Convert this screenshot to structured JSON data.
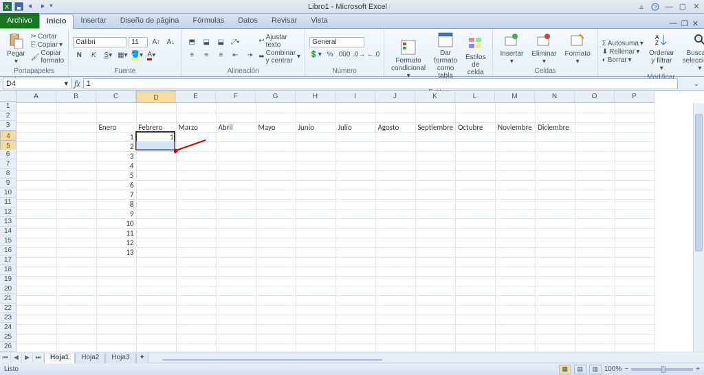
{
  "app": {
    "title": "Libro1 - Microsoft Excel"
  },
  "tabs": {
    "file": "Archivo",
    "items": [
      "Inicio",
      "Insertar",
      "Diseño de página",
      "Fórmulas",
      "Datos",
      "Revisar",
      "Vista"
    ],
    "active": 0
  },
  "ribbon": {
    "clipboard": {
      "paste": "Pegar",
      "cut": "Cortar",
      "copy": "Copiar",
      "format_painter": "Copiar formato",
      "label": "Portapapeles"
    },
    "font": {
      "name": "Calibri",
      "size": "11",
      "label": "Fuente"
    },
    "alignment": {
      "wrap": "Ajustar texto",
      "merge": "Combinar y centrar",
      "label": "Alineación"
    },
    "number": {
      "format": "General",
      "label": "Número"
    },
    "styles": {
      "cond": "Formato condicional",
      "table": "Dar formato como tabla",
      "cell": "Estilos de celda",
      "label": "Estilos"
    },
    "cells": {
      "insert": "Insertar",
      "delete": "Eliminar",
      "format": "Formato",
      "label": "Celdas"
    },
    "editing": {
      "autosum": "Autosuma",
      "fill": "Rellenar",
      "clear": "Borrar",
      "sort": "Ordenar y filtrar",
      "find": "Buscar y seleccionar",
      "label": "Modificar"
    }
  },
  "namebox": {
    "ref": "D4",
    "formula": "1"
  },
  "columns": [
    "A",
    "B",
    "C",
    "D",
    "E",
    "F",
    "G",
    "H",
    "I",
    "J",
    "K",
    "L",
    "M",
    "N",
    "O",
    "P"
  ],
  "rows_visible": 26,
  "chart_data": {
    "type": "table",
    "title": "Sheet data (months row 3, numbers column C starting row 4)",
    "cells": [
      {
        "ref": "C3",
        "value": "Enero"
      },
      {
        "ref": "D3",
        "value": "Febrero"
      },
      {
        "ref": "E3",
        "value": "Marzo"
      },
      {
        "ref": "F3",
        "value": "Abril"
      },
      {
        "ref": "G3",
        "value": "Mayo"
      },
      {
        "ref": "H3",
        "value": "Junio"
      },
      {
        "ref": "I3",
        "value": "Julio"
      },
      {
        "ref": "J3",
        "value": "Agosto"
      },
      {
        "ref": "K3",
        "value": "Septiembre"
      },
      {
        "ref": "L3",
        "value": "Octubre"
      },
      {
        "ref": "M3",
        "value": "Noviembre"
      },
      {
        "ref": "N3",
        "value": "Diciembre"
      },
      {
        "ref": "C4",
        "value": 1
      },
      {
        "ref": "C5",
        "value": 2
      },
      {
        "ref": "C6",
        "value": 3
      },
      {
        "ref": "C7",
        "value": 4
      },
      {
        "ref": "C8",
        "value": 5
      },
      {
        "ref": "C9",
        "value": 6
      },
      {
        "ref": "C10",
        "value": 7
      },
      {
        "ref": "C11",
        "value": 8
      },
      {
        "ref": "C12",
        "value": 9
      },
      {
        "ref": "C13",
        "value": 10
      },
      {
        "ref": "C14",
        "value": 11
      },
      {
        "ref": "C15",
        "value": 12
      },
      {
        "ref": "C16",
        "value": 13
      },
      {
        "ref": "D4",
        "value": 1
      }
    ],
    "selection": {
      "range": "D4:D5",
      "active": "D4"
    }
  },
  "sheets": {
    "items": [
      "Hoja1",
      "Hoja2",
      "Hoja3"
    ],
    "active": 0
  },
  "status": {
    "ready": "Listo",
    "zoom": "100%"
  }
}
